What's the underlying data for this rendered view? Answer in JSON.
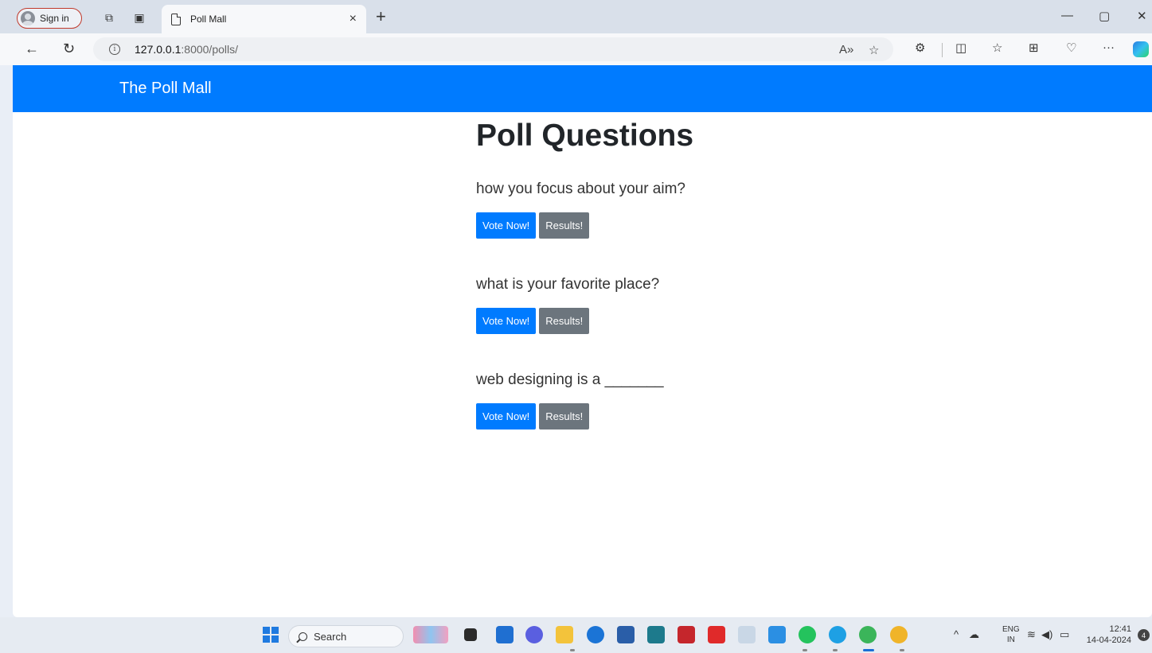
{
  "browser": {
    "signin_label": "Sign in",
    "tab_title": "Poll Mall",
    "tab_close": "×",
    "new_tab": "+",
    "url_host": "127.0.0.1",
    "url_path": ":8000/polls/",
    "minimize": "—",
    "restore": "▢",
    "close": "✕"
  },
  "page": {
    "brand": "The Poll Mall",
    "title": "Poll Questions",
    "questions": [
      {
        "text": "how you focus about your aim?",
        "vote_label": "Vote Now!",
        "results_label": "Results!"
      },
      {
        "text": "what is your favorite place?",
        "vote_label": "Vote Now!",
        "results_label": "Results!"
      },
      {
        "text": "web designing is a _______",
        "vote_label": "Vote Now!",
        "results_label": "Results!"
      }
    ]
  },
  "taskbar": {
    "search_label": "Search",
    "lang_top": "ENG",
    "lang_bottom": "IN",
    "time": "12:41",
    "date": "14-04-2024",
    "notification_count": "4"
  },
  "colors": {
    "navbar": "#007bff",
    "primary_button": "#007bff",
    "secondary_button": "#6c757d"
  }
}
